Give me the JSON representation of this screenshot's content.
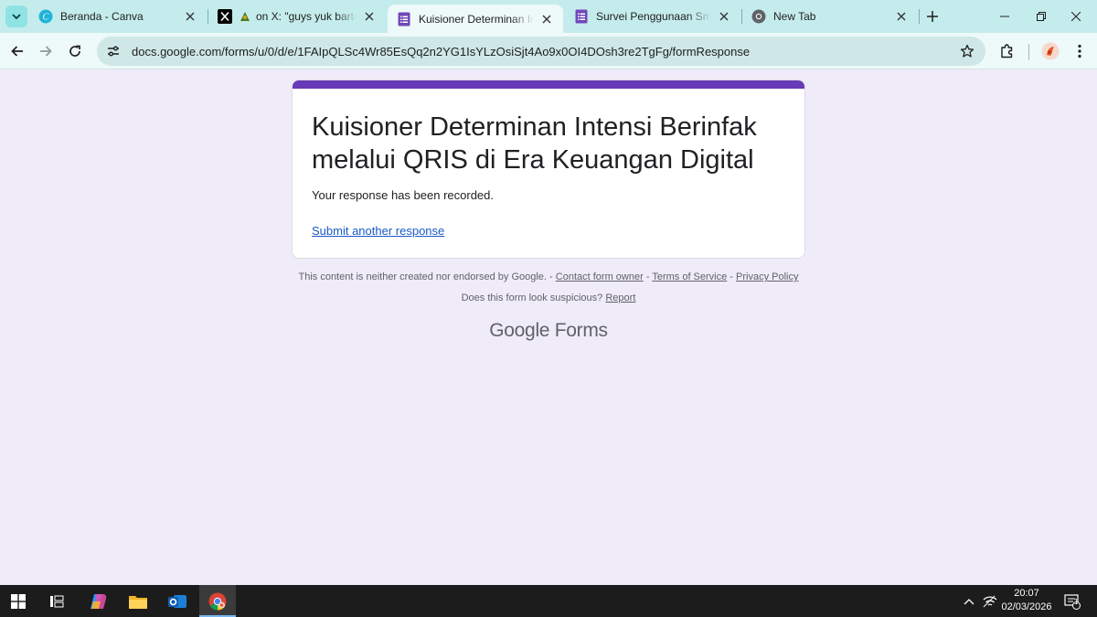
{
  "browser": {
    "tabs": [
      {
        "title": "Beranda - Canva",
        "icon": "canva-icon",
        "active": false
      },
      {
        "title": "on X: \"guys yuk barter kuesioner",
        "icon": "x-icon",
        "active": false
      },
      {
        "title": "Kuisioner Determinan Intensi Berinfak",
        "icon": "google-forms-icon",
        "active": true
      },
      {
        "title": "Survei Penggunaan Smartphone",
        "icon": "google-forms-icon",
        "active": false
      },
      {
        "title": "New Tab",
        "icon": "chrome-icon",
        "active": false
      }
    ],
    "url": "docs.google.com/forms/u/0/d/e/1FAIpQLSc4Wr85EsQq2n2YG1IsYLzOsiSjt4Ao9x0OI4DOsh3re2TgFg/formResponse"
  },
  "form": {
    "title": "Kuisioner Determinan Intensi Berinfak melalui QRIS di Era Keuangan Digital",
    "confirmation": "Your response has been recorded.",
    "submit_another": "Submit another response",
    "accent_color": "#673ab7"
  },
  "footer": {
    "disclaimer": "This content is neither created nor endorsed by Google.",
    "sep": " - ",
    "contact": "Contact form owner",
    "terms": "Terms of Service",
    "privacy": "Privacy Policy",
    "suspicious": "Does this form look suspicious?",
    "report": "Report",
    "brand_google": "Google",
    "brand_forms": "Forms"
  },
  "taskbar": {
    "time": "20:07",
    "date": "02/03/2026",
    "notification_count": "1"
  }
}
